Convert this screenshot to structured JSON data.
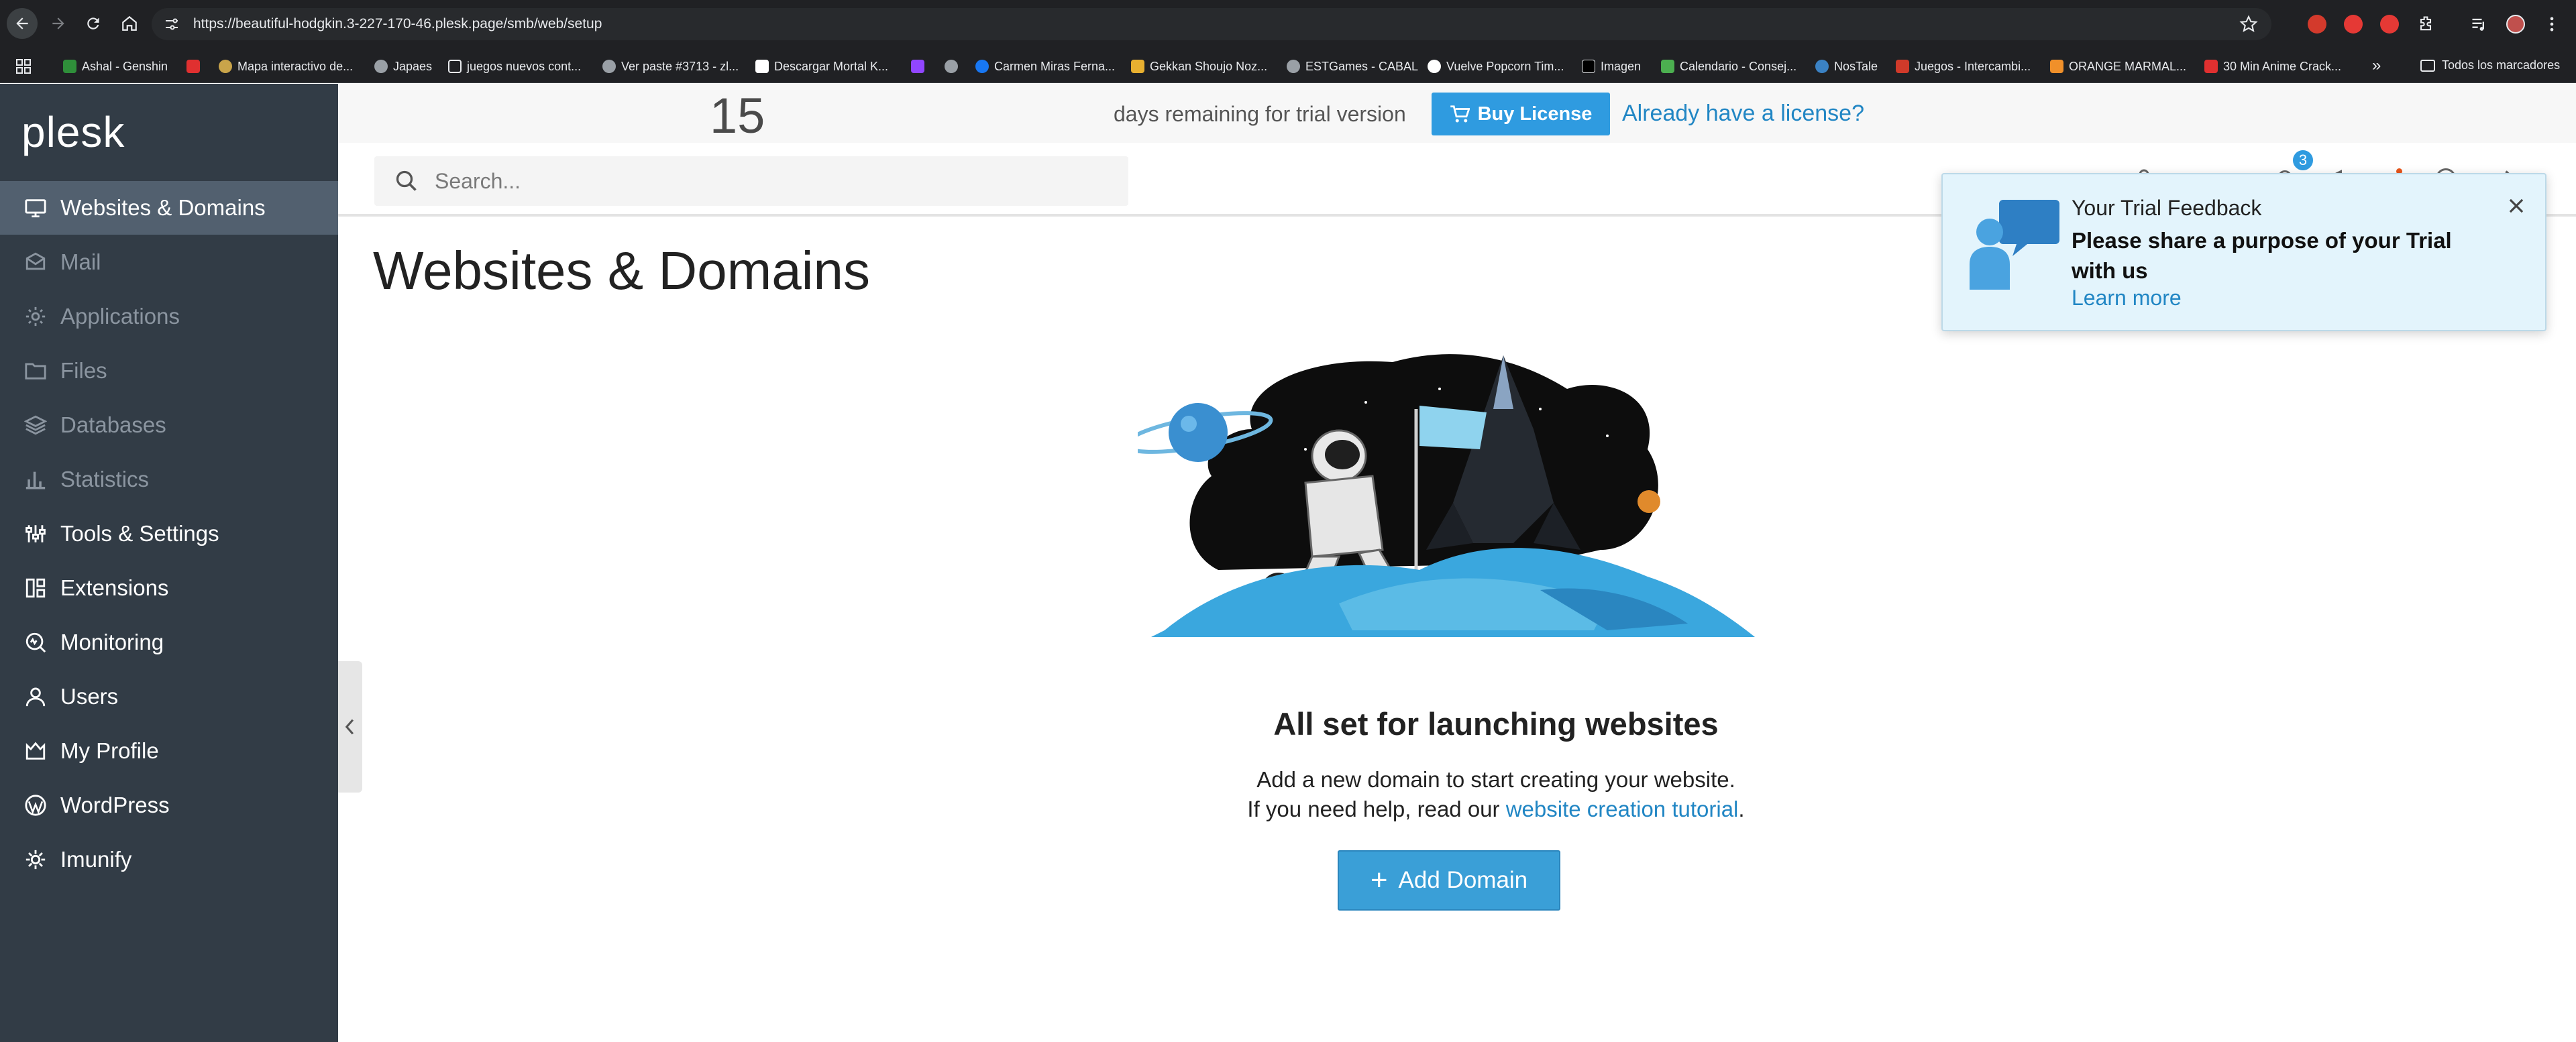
{
  "browser": {
    "url": "https://beautiful-hodgkin.3-227-170-46.plesk.page/smb/web/setup",
    "bookmarks": [
      {
        "label": "Ashal - Genshin",
        "color": "#2f8f3a"
      },
      {
        "label": "",
        "color": "#e03030"
      },
      {
        "label": "Mapa interactivo de...",
        "color": "#c9a44a"
      },
      {
        "label": "Japaes",
        "color": "#9aa0a6"
      },
      {
        "label": "juegos nuevos cont...",
        "color": "#9aa0a6"
      },
      {
        "label": "Ver paste #3713 - zl...",
        "color": "#9aa0a6"
      },
      {
        "label": "Descargar Mortal K...",
        "color": "#ffffff"
      },
      {
        "label": "",
        "color": "#9aa0a6"
      },
      {
        "label": "",
        "color": "#9146ff"
      },
      {
        "label": "Carmen Miras Ferna...",
        "color": "#1877f2"
      },
      {
        "label": "Gekkan Shoujo Noz...",
        "color": "#e8b030"
      },
      {
        "label": "ESTGames - CABAL",
        "color": "#9aa0a6"
      },
      {
        "label": "Vuelve Popcorn Tim...",
        "color": "#ffffff"
      },
      {
        "label": "Imagen",
        "color": "#000000"
      },
      {
        "label": "Calendario - Consej...",
        "color": "#4caf50"
      },
      {
        "label": "NosTale",
        "color": "#3b82c4"
      },
      {
        "label": "Juegos - Intercambi...",
        "color": "#d03a2a"
      },
      {
        "label": "ORANGE MARMAL...",
        "color": "#f0902a"
      },
      {
        "label": "30 Min Anime Crack...",
        "color": "#e03030"
      }
    ],
    "more": "»",
    "all_bookmarks": "Todos los marcadores"
  },
  "sidebar": {
    "logo": "plesk",
    "items": [
      {
        "label": "Websites & Domains",
        "icon": "monitor-icon"
      },
      {
        "label": "Mail",
        "icon": "envelope-icon"
      },
      {
        "label": "Applications",
        "icon": "gear-icon"
      },
      {
        "label": "Files",
        "icon": "folder-icon"
      },
      {
        "label": "Databases",
        "icon": "layers-icon"
      },
      {
        "label": "Statistics",
        "icon": "bar-chart-icon"
      },
      {
        "label": "Tools & Settings",
        "icon": "sliders-icon"
      },
      {
        "label": "Extensions",
        "icon": "blocks-icon"
      },
      {
        "label": "Monitoring",
        "icon": "monitoring-icon"
      },
      {
        "label": "Users",
        "icon": "user-icon"
      },
      {
        "label": "My Profile",
        "icon": "profile-icon"
      },
      {
        "label": "WordPress",
        "icon": "wordpress-icon"
      },
      {
        "label": "Imunify",
        "icon": "shield-gear-icon"
      }
    ]
  },
  "trial": {
    "days": "15",
    "text": "days remaining for trial version",
    "buy_label": "Buy License",
    "license_link": "Already have a license?"
  },
  "search": {
    "placeholder": "Search..."
  },
  "notifications": {
    "count": "3"
  },
  "page": {
    "title": "Websites & Domains"
  },
  "empty_state": {
    "title": "All set for launching websites",
    "line1": "Add a new domain to start creating your website.",
    "line2_prefix": "If you need help, read our ",
    "line2_link": "website creation tutorial",
    "line2_suffix": ".",
    "button": "Add Domain"
  },
  "popup": {
    "title": "Your Trial Feedback",
    "body": "Please share a purpose of your Trial with us",
    "link": "Learn more"
  },
  "colors": {
    "sidebar_bg": "#323c46",
    "sidebar_active": "#52606f",
    "accent": "#2f9be0",
    "link": "#2186c4",
    "popup_bg": "#e3f4fc"
  }
}
